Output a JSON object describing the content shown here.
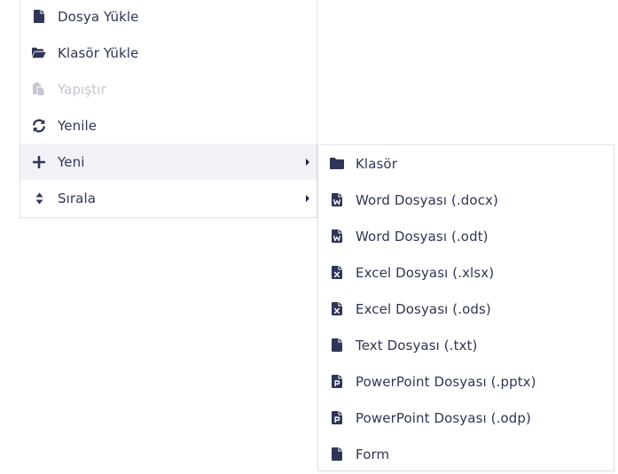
{
  "colors": {
    "icon": "#2f3556",
    "text": "#2f3556",
    "disabled": "#c3c6d0",
    "hover_bg": "#f1f2f5",
    "border": "#e1e3ea"
  },
  "main_menu": {
    "items": [
      {
        "label": "Dosya Yükle",
        "icon": "file-icon"
      },
      {
        "label": "Klasör Yükle",
        "icon": "folder-open-icon"
      },
      {
        "label": "Yapıştır",
        "icon": "paste-icon",
        "disabled": true
      },
      {
        "label": "Yenile",
        "icon": "refresh-icon"
      },
      {
        "label": "Yeni",
        "icon": "plus-icon",
        "has_submenu": true,
        "active": true
      },
      {
        "label": "Sırala",
        "icon": "sort-icon",
        "has_submenu": true
      }
    ]
  },
  "submenu_new": {
    "items": [
      {
        "label": "Klasör",
        "icon": "folder-icon"
      },
      {
        "label": "Word Dosyası (.docx)",
        "icon": "word-file-icon"
      },
      {
        "label": "Word Dosyası (.odt)",
        "icon": "word-file-icon"
      },
      {
        "label": "Excel Dosyası (.xlsx)",
        "icon": "excel-file-icon"
      },
      {
        "label": "Excel Dosyası (.ods)",
        "icon": "excel-file-icon"
      },
      {
        "label": "Text Dosyası (.txt)",
        "icon": "file-icon"
      },
      {
        "label": "PowerPoint Dosyası (.pptx)",
        "icon": "powerpoint-file-icon"
      },
      {
        "label": "PowerPoint Dosyası (.odp)",
        "icon": "powerpoint-file-icon"
      },
      {
        "label": "Form",
        "icon": "file-icon"
      }
    ]
  }
}
